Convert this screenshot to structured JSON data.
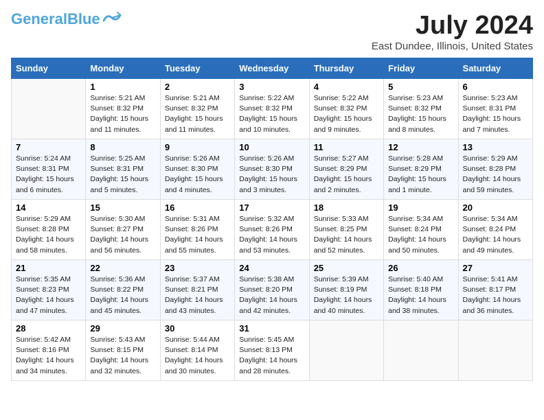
{
  "header": {
    "logo_line1": "General",
    "logo_line2": "Blue",
    "month": "July 2024",
    "location": "East Dundee, Illinois, United States"
  },
  "weekdays": [
    "Sunday",
    "Monday",
    "Tuesday",
    "Wednesday",
    "Thursday",
    "Friday",
    "Saturday"
  ],
  "weeks": [
    [
      {
        "day": "",
        "info": ""
      },
      {
        "day": "1",
        "info": "Sunrise: 5:21 AM\nSunset: 8:32 PM\nDaylight: 15 hours\nand 11 minutes."
      },
      {
        "day": "2",
        "info": "Sunrise: 5:21 AM\nSunset: 8:32 PM\nDaylight: 15 hours\nand 11 minutes."
      },
      {
        "day": "3",
        "info": "Sunrise: 5:22 AM\nSunset: 8:32 PM\nDaylight: 15 hours\nand 10 minutes."
      },
      {
        "day": "4",
        "info": "Sunrise: 5:22 AM\nSunset: 8:32 PM\nDaylight: 15 hours\nand 9 minutes."
      },
      {
        "day": "5",
        "info": "Sunrise: 5:23 AM\nSunset: 8:32 PM\nDaylight: 15 hours\nand 8 minutes."
      },
      {
        "day": "6",
        "info": "Sunrise: 5:23 AM\nSunset: 8:31 PM\nDaylight: 15 hours\nand 7 minutes."
      }
    ],
    [
      {
        "day": "7",
        "info": "Sunrise: 5:24 AM\nSunset: 8:31 PM\nDaylight: 15 hours\nand 6 minutes."
      },
      {
        "day": "8",
        "info": "Sunrise: 5:25 AM\nSunset: 8:31 PM\nDaylight: 15 hours\nand 5 minutes."
      },
      {
        "day": "9",
        "info": "Sunrise: 5:26 AM\nSunset: 8:30 PM\nDaylight: 15 hours\nand 4 minutes."
      },
      {
        "day": "10",
        "info": "Sunrise: 5:26 AM\nSunset: 8:30 PM\nDaylight: 15 hours\nand 3 minutes."
      },
      {
        "day": "11",
        "info": "Sunrise: 5:27 AM\nSunset: 8:29 PM\nDaylight: 15 hours\nand 2 minutes."
      },
      {
        "day": "12",
        "info": "Sunrise: 5:28 AM\nSunset: 8:29 PM\nDaylight: 15 hours\nand 1 minute."
      },
      {
        "day": "13",
        "info": "Sunrise: 5:29 AM\nSunset: 8:28 PM\nDaylight: 14 hours\nand 59 minutes."
      }
    ],
    [
      {
        "day": "14",
        "info": "Sunrise: 5:29 AM\nSunset: 8:28 PM\nDaylight: 14 hours\nand 58 minutes."
      },
      {
        "day": "15",
        "info": "Sunrise: 5:30 AM\nSunset: 8:27 PM\nDaylight: 14 hours\nand 56 minutes."
      },
      {
        "day": "16",
        "info": "Sunrise: 5:31 AM\nSunset: 8:26 PM\nDaylight: 14 hours\nand 55 minutes."
      },
      {
        "day": "17",
        "info": "Sunrise: 5:32 AM\nSunset: 8:26 PM\nDaylight: 14 hours\nand 53 minutes."
      },
      {
        "day": "18",
        "info": "Sunrise: 5:33 AM\nSunset: 8:25 PM\nDaylight: 14 hours\nand 52 minutes."
      },
      {
        "day": "19",
        "info": "Sunrise: 5:34 AM\nSunset: 8:24 PM\nDaylight: 14 hours\nand 50 minutes."
      },
      {
        "day": "20",
        "info": "Sunrise: 5:34 AM\nSunset: 8:24 PM\nDaylight: 14 hours\nand 49 minutes."
      }
    ],
    [
      {
        "day": "21",
        "info": "Sunrise: 5:35 AM\nSunset: 8:23 PM\nDaylight: 14 hours\nand 47 minutes."
      },
      {
        "day": "22",
        "info": "Sunrise: 5:36 AM\nSunset: 8:22 PM\nDaylight: 14 hours\nand 45 minutes."
      },
      {
        "day": "23",
        "info": "Sunrise: 5:37 AM\nSunset: 8:21 PM\nDaylight: 14 hours\nand 43 minutes."
      },
      {
        "day": "24",
        "info": "Sunrise: 5:38 AM\nSunset: 8:20 PM\nDaylight: 14 hours\nand 42 minutes."
      },
      {
        "day": "25",
        "info": "Sunrise: 5:39 AM\nSunset: 8:19 PM\nDaylight: 14 hours\nand 40 minutes."
      },
      {
        "day": "26",
        "info": "Sunrise: 5:40 AM\nSunset: 8:18 PM\nDaylight: 14 hours\nand 38 minutes."
      },
      {
        "day": "27",
        "info": "Sunrise: 5:41 AM\nSunset: 8:17 PM\nDaylight: 14 hours\nand 36 minutes."
      }
    ],
    [
      {
        "day": "28",
        "info": "Sunrise: 5:42 AM\nSunset: 8:16 PM\nDaylight: 14 hours\nand 34 minutes."
      },
      {
        "day": "29",
        "info": "Sunrise: 5:43 AM\nSunset: 8:15 PM\nDaylight: 14 hours\nand 32 minutes."
      },
      {
        "day": "30",
        "info": "Sunrise: 5:44 AM\nSunset: 8:14 PM\nDaylight: 14 hours\nand 30 minutes."
      },
      {
        "day": "31",
        "info": "Sunrise: 5:45 AM\nSunset: 8:13 PM\nDaylight: 14 hours\nand 28 minutes."
      },
      {
        "day": "",
        "info": ""
      },
      {
        "day": "",
        "info": ""
      },
      {
        "day": "",
        "info": ""
      }
    ]
  ]
}
